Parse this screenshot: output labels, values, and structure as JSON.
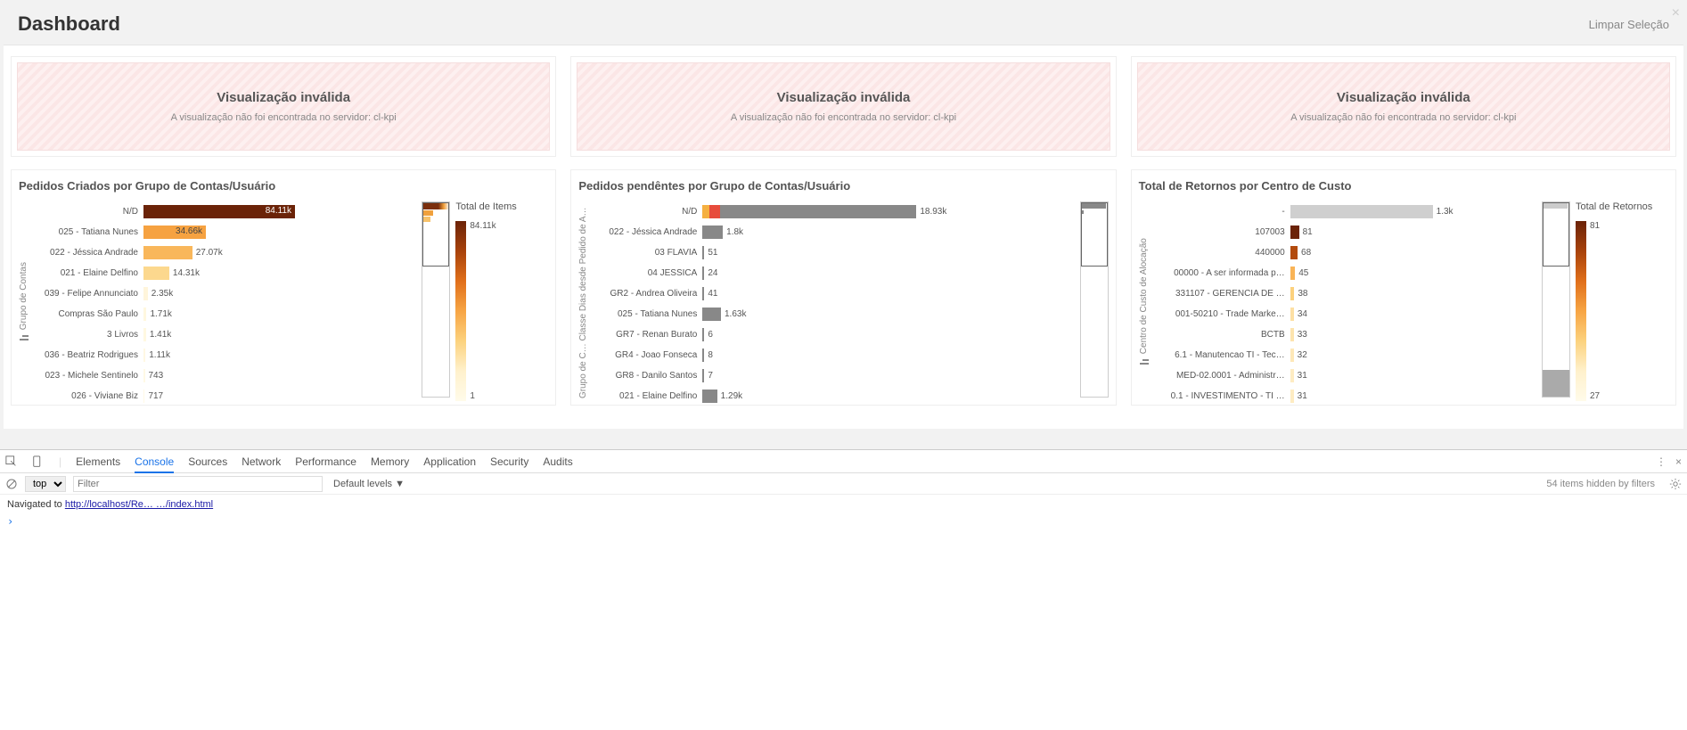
{
  "header": {
    "title": "Dashboard",
    "clear_link": "Limpar Seleção"
  },
  "invalid": {
    "title": "Visualização inválida",
    "message": "A visualização não foi encontrada no servidor: cl-kpi"
  },
  "charts": {
    "c1": {
      "title": "Pedidos Criados por Grupo de Contas/Usuário",
      "ylabel": "Grupo de Contas",
      "legend_title": "Total de Items",
      "legend_max": "84.11k",
      "legend_min": "1"
    },
    "c2": {
      "title": "Pedidos pendêntes por Grupo de Contas/Usuário",
      "ylabel": "Grupo de C…   Classe Dias desde Pedido de A…",
      "legend_title": ""
    },
    "c3": {
      "title": "Total de Retornos por Centro de Custo",
      "ylabel": "Centro de Custo de Alocação",
      "legend_title": "Total de Retornos",
      "legend_max": "81",
      "legend_min": "27"
    }
  },
  "chart_data": [
    {
      "type": "bar",
      "orientation": "horizontal",
      "title": "Pedidos Criados por Grupo de Contas/Usuário",
      "xlabel": "",
      "ylabel": "Grupo de Contas",
      "categories": [
        "N/D",
        "025 - Tatiana Nunes",
        "022 - Jéssica Andrade",
        "021 - Elaine Delfino",
        "039 - Felipe Annunciato",
        "Compras São Paulo",
        "3 Livros",
        "036 - Beatriz Rodrigues",
        "023 - Michele Sentinelo",
        "026 - Viviane Biz"
      ],
      "values": [
        84110,
        34660,
        27070,
        14310,
        2350,
        1710,
        1410,
        1110,
        743,
        717
      ],
      "value_labels": [
        "84.11k",
        "34.66k",
        "27.07k",
        "14.31k",
        "2.35k",
        "1.71k",
        "1.41k",
        "1.11k",
        "743",
        "717"
      ],
      "color_scale": {
        "min": 1,
        "max": 84110,
        "palette": "YlOrBr"
      }
    },
    {
      "type": "bar",
      "orientation": "horizontal",
      "stacked": true,
      "title": "Pedidos pendêntes por Grupo de Contas/Usuário",
      "xlabel": "",
      "ylabel": "Grupo de Contas / Classe Dias desde Pedido de A…",
      "categories": [
        "N/D",
        "022 - Jéssica Andrade",
        "03 FLAVIA",
        "04 JESSICA",
        "GR2 - Andrea Oliveira",
        "025 - Tatiana Nunes",
        "GR7 - Renan Burato",
        "GR4 - Joao Fonseca",
        "GR8 - Danilo Santos",
        "021 - Elaine Delfino"
      ],
      "values": [
        18930,
        1800,
        51,
        24,
        41,
        1630,
        6,
        8,
        7,
        1290
      ],
      "value_labels": [
        "18.93k",
        "1.8k",
        "51",
        "24",
        "41",
        "1.63k",
        "6",
        "8",
        "7",
        "1.29k"
      ],
      "series_colors": [
        "#f5b041",
        "#e74c3c",
        "#888"
      ]
    },
    {
      "type": "bar",
      "orientation": "horizontal",
      "title": "Total de Retornos por Centro de Custo",
      "xlabel": "",
      "ylabel": "Centro de Custo de Alocação",
      "categories": [
        "-",
        "107003",
        "440000",
        "00000 - A ser informada p…",
        "331107 - GERENCIA DE …",
        "001-50210 - Trade Marke…",
        "BCTB",
        "6.1 - Manutencao TI - Tec…",
        "MED-02.0001 - Administr…",
        "0.1 - INVESTIMENTO - TI …"
      ],
      "values": [
        1300,
        81,
        68,
        45,
        38,
        34,
        33,
        32,
        31,
        31
      ],
      "value_labels": [
        "1.3k",
        "81",
        "68",
        "45",
        "38",
        "34",
        "33",
        "32",
        "31",
        "31"
      ],
      "color_scale": {
        "min": 27,
        "max": 81,
        "palette": "YlOrBr"
      }
    }
  ],
  "devtools": {
    "tabs": [
      "Elements",
      "Console",
      "Sources",
      "Network",
      "Performance",
      "Memory",
      "Application",
      "Security",
      "Audits"
    ],
    "active_tab": "Console",
    "context": "top",
    "filter_placeholder": "Filter",
    "levels": "Default levels ▼",
    "hidden": "54 items hidden by filters",
    "log_prefix": "Navigated to ",
    "log_url": "http://localhost/Re… …/index.html"
  }
}
